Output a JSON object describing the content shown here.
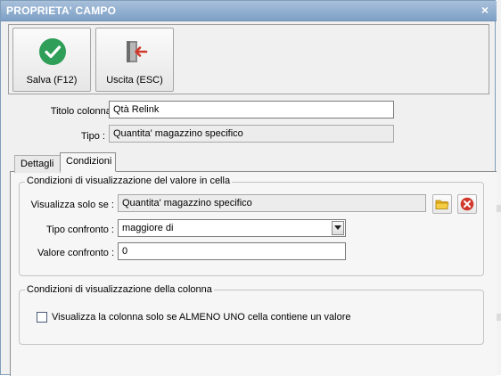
{
  "dialog": {
    "title": "PROPRIETA' CAMPO",
    "close_symbol": "×"
  },
  "toolbar": {
    "save_label": "Salva (F12)",
    "exit_label": "Uscita (ESC)",
    "save_icon": "check-circle-icon",
    "exit_icon": "exit-door-icon",
    "save_color": "#2e9e58",
    "exit_color": "#d0392b"
  },
  "fields": {
    "column_title_label": "Titolo colonna :",
    "column_title_value": "Qtà Relink",
    "type_label": "Tipo :",
    "type_value": "Quantita' magazzino specifico"
  },
  "tabs": [
    {
      "label": "Dettagli",
      "active": false
    },
    {
      "label": "Condizioni",
      "active": true
    }
  ],
  "cell_conditions": {
    "group_title": "Condizioni di visualizzazione del valore in cella",
    "show_only_if_label": "Visualizza solo se :",
    "show_only_if_value": "Quantita' magazzino specifico",
    "browse_icon": "folder-icon",
    "clear_icon": "delete-x-icon",
    "compare_type_label": "Tipo confronto :",
    "compare_type_value": "maggiore di",
    "compare_value_label": "Valore confronto :",
    "compare_value": "0"
  },
  "column_conditions": {
    "group_title": "Condizioni di visualizzazione della colonna",
    "checkbox_label": "Visualizza la colonna solo se ALMENO UNO cella contiene un valore",
    "checked": false
  }
}
